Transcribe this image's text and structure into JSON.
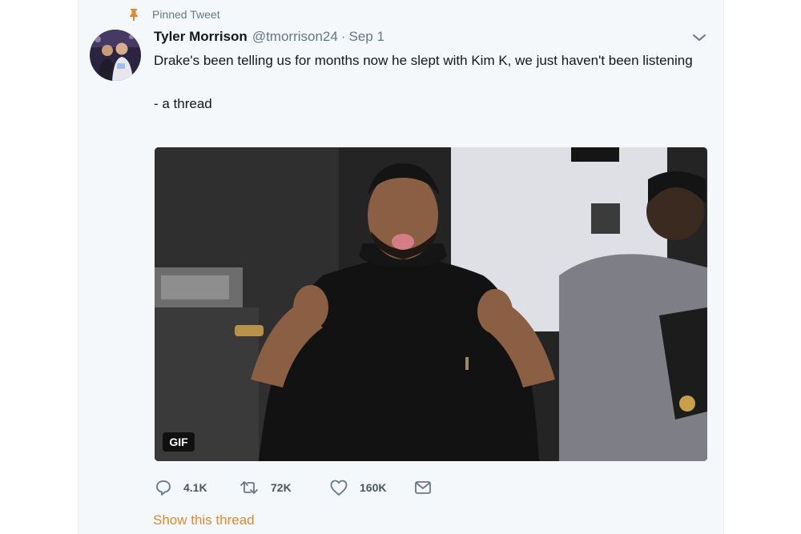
{
  "pinned": {
    "label": "Pinned Tweet",
    "icon": "pin-icon"
  },
  "tweet": {
    "author_name": "Tyler Morrison",
    "handle": "@tmorrison24",
    "separator": "·",
    "date": "Sep 1",
    "text_line1": "Drake's been telling us for months now he slept with Kim K, we just haven't been listening",
    "text_line2": "- a thread",
    "media_badge": "GIF"
  },
  "actions": {
    "replies": "4.1K",
    "retweets": "72K",
    "likes": "160K"
  },
  "show_thread": "Show this thread",
  "colors": {
    "accent": "#e0892e",
    "secondary_text": "#657786",
    "primary_text": "#14171a",
    "card_background": "#f5f8fa"
  },
  "icons": [
    "pin-icon",
    "chevron-down-icon",
    "reply-icon",
    "retweet-icon",
    "heart-icon",
    "message-icon"
  ]
}
